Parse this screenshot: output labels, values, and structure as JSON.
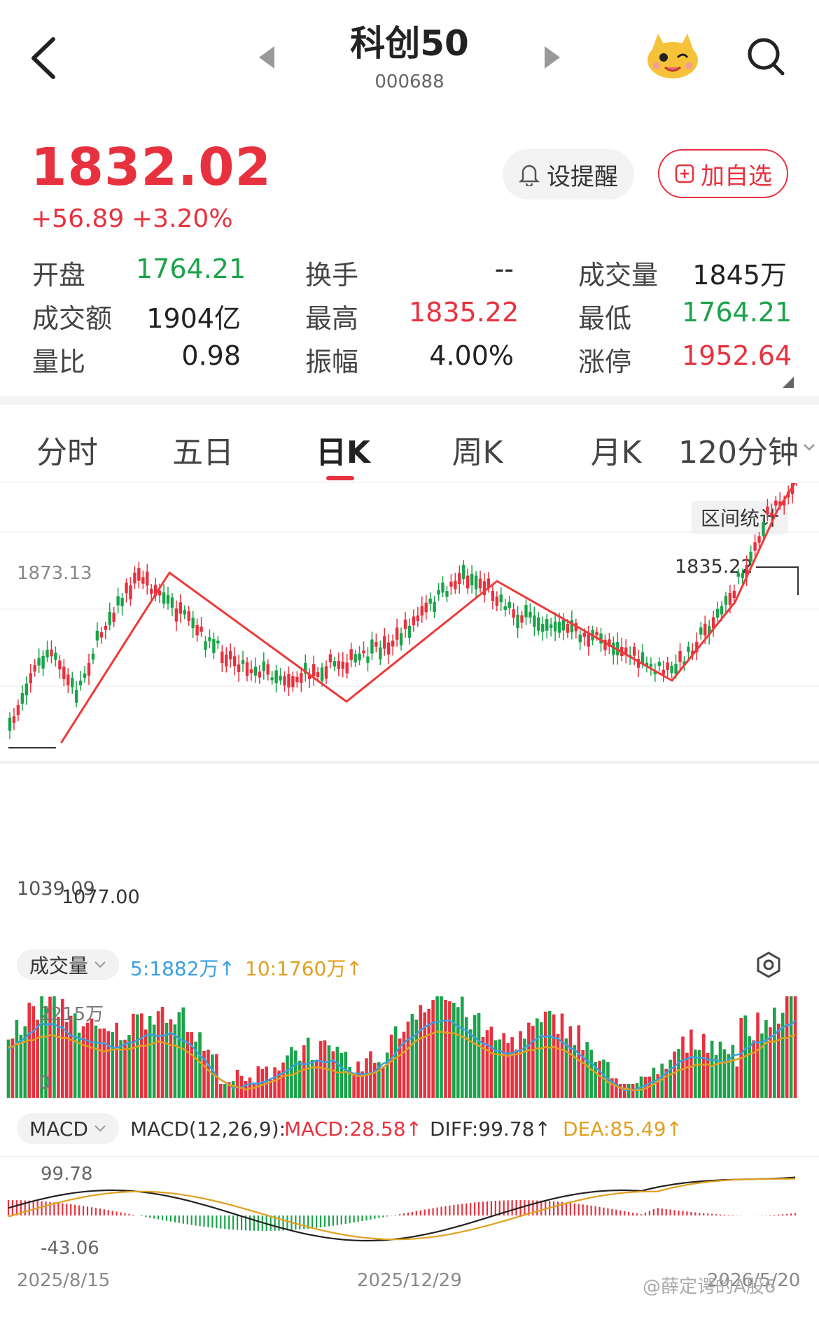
{
  "header": {
    "title": "科创50",
    "code": "000688"
  },
  "quote": {
    "price": "1832.02",
    "change": "+56.89",
    "change_pct": "+3.20%"
  },
  "buttons": {
    "alert": "设提醒",
    "watchlist": "加自选"
  },
  "stats": [
    {
      "label": "开盘",
      "value": "1764.21",
      "color": "green"
    },
    {
      "label": "换手",
      "value": "--",
      "color": "neutral"
    },
    {
      "label": "成交量",
      "value": "1845万",
      "color": "neutral"
    },
    {
      "label": "成交额",
      "value": "1904亿",
      "color": "neutral"
    },
    {
      "label": "最高",
      "value": "1835.22",
      "color": "red"
    },
    {
      "label": "最低",
      "value": "1764.21",
      "color": "green"
    },
    {
      "label": "量比",
      "value": "0.98",
      "color": "neutral"
    },
    {
      "label": "振幅",
      "value": "4.00%",
      "color": "neutral"
    },
    {
      "label": "涨停",
      "value": "1952.64",
      "color": "red"
    }
  ],
  "tabs": [
    {
      "label": "分时"
    },
    {
      "label": "五日"
    },
    {
      "label": "日K",
      "active": true
    },
    {
      "label": "周K"
    },
    {
      "label": "月K"
    },
    {
      "label": "120分钟"
    }
  ],
  "range_stats_label": "区间统计",
  "kline": {
    "y_top_label": "1873.13",
    "high_marker": "1835.22",
    "low_marker": "1039.09",
    "low_marker2": "1077.00"
  },
  "volume": {
    "indicator_label": "成交量",
    "ma5": "5:1882万",
    "ma10": "10:1760万",
    "y_label": "2215万",
    "y_zero": "0"
  },
  "macd": {
    "indicator_label": "MACD",
    "params": "MACD(12,26,9):",
    "macd_value": "MACD:28.58",
    "diff_value": "DIFF:99.78",
    "dea_value": "DEA:85.49",
    "y_top": "99.78",
    "y_bottom": "-43.06"
  },
  "dates": [
    "2025/8/15",
    "2025/12/29",
    "2026/5/20"
  ],
  "watermark": "@薛定谔的A股6",
  "colors": {
    "up": "#e8313e",
    "down": "#1aa34a",
    "ma5": "#3aa0e0",
    "ma10": "#e0a020",
    "diff": "#222222",
    "dea": "#e0a020"
  },
  "icons": [
    "back-arrow-icon",
    "prev-arrow-icon",
    "next-arrow-icon",
    "mascot-icon",
    "search-icon",
    "bell-icon",
    "plus-box-icon",
    "chevron-down-icon",
    "settings-icon"
  ]
}
